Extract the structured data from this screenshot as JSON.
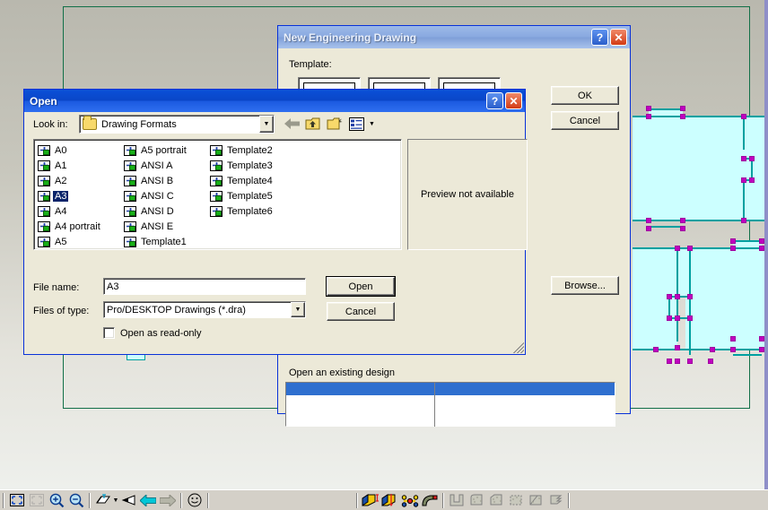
{
  "app": {
    "canvas": {
      "sheet_border_color": "#127048",
      "sketch_fill_color": "#ccffff",
      "sketch_edge_color": "#00a0a0",
      "vertex_handle_color": "#c000c0",
      "background_top_color": "#b9b8ae",
      "background_bottom_color": "#eef0ec"
    },
    "toolbar": {
      "left_group": [
        {
          "name": "zoom-fit-icon",
          "tooltip": "Zoom to fit",
          "enabled": true
        },
        {
          "name": "zoom-selection-icon",
          "tooltip": "Zoom to selection",
          "enabled": false
        },
        {
          "name": "zoom-in-icon",
          "tooltip": "Zoom in",
          "enabled": true
        },
        {
          "name": "zoom-out-icon",
          "tooltip": "Zoom out",
          "enabled": true
        }
      ],
      "view_group": [
        {
          "name": "view-plane-icon",
          "tooltip": "Workplane view",
          "enabled": true
        },
        {
          "name": "view-dropdown-arrow-icon",
          "tooltip": "More views",
          "enabled": true
        },
        {
          "name": "view-direction-icon",
          "tooltip": "View direction",
          "enabled": true
        },
        {
          "name": "back-arrow-icon",
          "tooltip": "Previous view",
          "enabled": true
        },
        {
          "name": "forward-arrow-icon",
          "tooltip": "Next view",
          "enabled": false
        }
      ],
      "face_group": [
        {
          "name": "smiley-icon",
          "tooltip": "Shaded view",
          "enabled": true
        }
      ],
      "feature_group": [
        {
          "name": "extrude-icon",
          "tooltip": "Extrude profile",
          "enabled": true
        },
        {
          "name": "revolve-icon",
          "tooltip": "Revolve profile",
          "enabled": true
        },
        {
          "name": "sweep-icon",
          "tooltip": "Sweep profile",
          "enabled": true
        },
        {
          "name": "loft-icon",
          "tooltip": "Loft profile",
          "enabled": true
        }
      ],
      "modify_group": [
        {
          "name": "shell-icon",
          "tooltip": "Shell",
          "enabled": false
        },
        {
          "name": "round-edges-icon",
          "tooltip": "Round edges",
          "enabled": false
        },
        {
          "name": "chamfer-edges-icon",
          "tooltip": "Chamfer edges",
          "enabled": false
        },
        {
          "name": "draft-faces-icon",
          "tooltip": "Draft faces",
          "enabled": false
        },
        {
          "name": "taper-icon",
          "tooltip": "Taper",
          "enabled": false
        },
        {
          "name": "thread-icon",
          "tooltip": "Thread",
          "enabled": false
        }
      ]
    }
  },
  "new_drawing_dialog": {
    "title": "New Engineering Drawing",
    "active": false,
    "help_label": "?",
    "close_label": "✕",
    "template_label": "Template:",
    "templates": [
      {
        "name": "template-thumb-1"
      },
      {
        "name": "template-thumb-2"
      },
      {
        "name": "template-thumb-3"
      }
    ],
    "ok_label": "OK",
    "cancel_label": "Cancel",
    "browse_label": "Browse...",
    "existing_design_label": "Open an existing design",
    "list_header_label": ""
  },
  "open_dialog": {
    "title": "Open",
    "active": true,
    "help_label": "?",
    "close_label": "✕",
    "look_in_label": "Look in:",
    "look_in_value": "Drawing Formats",
    "nav_buttons": [
      {
        "name": "back-arrow-icon",
        "tooltip": "Back",
        "enabled": false
      },
      {
        "name": "up-one-level-icon",
        "tooltip": "Up One Level",
        "enabled": true
      },
      {
        "name": "new-folder-icon",
        "tooltip": "Create New Folder",
        "enabled": true
      },
      {
        "name": "views-icon",
        "tooltip": "Views",
        "enabled": true
      },
      {
        "name": "views-dropdown-arrow-icon",
        "tooltip": "Views menu",
        "enabled": true
      }
    ],
    "files": [
      "A0",
      "A1",
      "A2",
      "A3",
      "A4",
      "A4 portrait",
      "A5",
      "A5 portrait",
      "ANSI A",
      "ANSI B",
      "ANSI C",
      "ANSI D",
      "ANSI E",
      "Template1",
      "Template2",
      "Template3",
      "Template4",
      "Template5",
      "Template6"
    ],
    "selected_file": "A3",
    "preview_text": "Preview not available",
    "file_name_label": "File name:",
    "file_name_value": "A3",
    "files_of_type_label": "Files of type:",
    "files_of_type_value": "Pro/DESKTOP Drawings (*.dra)",
    "files_of_type_options": [
      "Pro/DESKTOP Drawings (*.dra)"
    ],
    "open_label": "Open",
    "cancel_label": "Cancel",
    "read_only_label": "Open as read-only",
    "read_only_checked": false,
    "resize_grip": "resize-grip"
  }
}
